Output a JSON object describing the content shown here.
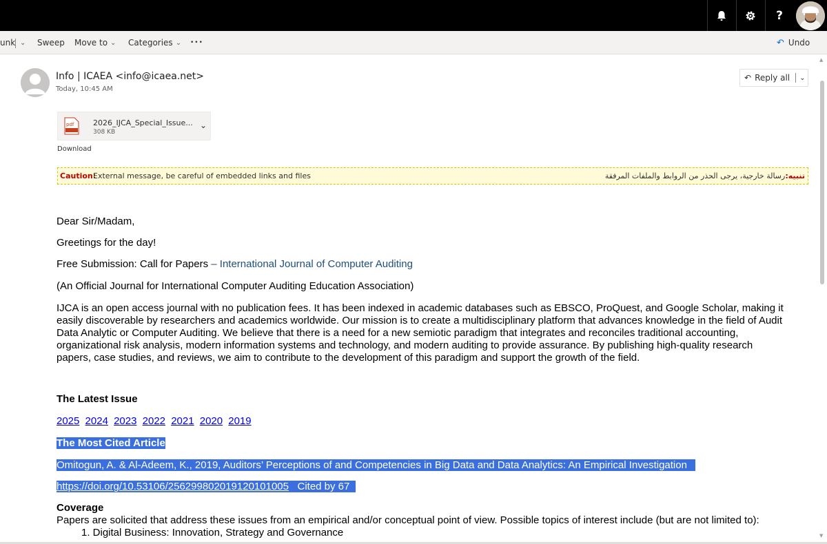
{
  "topbar": {
    "icons": [
      "bell-icon",
      "gear-icon",
      "help-icon",
      "profile-avatar"
    ],
    "help_label": "?"
  },
  "commandbar": {
    "junk_label": "unk",
    "sweep_label": "Sweep",
    "move_label": "Move to",
    "categories_label": "Categories",
    "more_label": "•••",
    "undo_label": "Undo"
  },
  "message": {
    "sender": "Info | ICAEA <info@icaea.net>",
    "time": "Today, 10:45 AM",
    "reply_label": "Reply all",
    "attachment": {
      "icon_text": "pdf",
      "name": "2026_IJCA_Special_Issue...",
      "size": "308 KB"
    },
    "download_label": "Download",
    "caution": {
      "label": "Caution:",
      "text": "External message, be careful of embedded links and files",
      "ar_label": "تنبيه:",
      "ar_text": "رسالة خارجية، يرجى الحذر من الروابط والملفات المرفقة"
    }
  },
  "email": {
    "salutation": "Dear Sir/Madam,",
    "greeting": "Greetings for the day!",
    "cfp_prefix": "Free Submission: Call for Papers ",
    "cfp_link": "– International Journal of Computer Auditing",
    "official": "(An Official Journal for International Computer Auditing Education Association)",
    "intro_lines": [
      "IJCA is an open access journal with no publication fees. It has been indexed in academic databases such as EBSCO, ProQuest, and Google Scholar, making it",
      "easily discoverable by researchers and academics worldwide. Our mission is to create a multidisciplinary platform that advances knowledge in the field of Audit",
      "Data Analytic or Computer Auditing. We believe that there is a need for a new semiotic paradigm that integrates and reconciles traditional accounting,",
      "organizational risk analysis, modern information systems and technology, and modern auditing to provide assurance. By publishing high-quality research",
      "papers, case studies, and reviews, we aim to contribute to the development of this paradigm and support the growth of the field."
    ],
    "latest_issue_heading": "The Latest Issue",
    "years": [
      "2025",
      "2024",
      "2023",
      "2022",
      "2021",
      "2020",
      "2019"
    ],
    "most_cited_heading": "The Most Cited Article",
    "citation": "Omitogun, A. & Al-Adeem, K., 2019, Auditors’ Perceptions of and Competencies in Big Data and Data Analytics: An Empirical Investigation ",
    "doi": "https://doi.org/10.53106/25629980201912010100",
    "doi_last": "5",
    "cited_by": "   Cited by 67  ",
    "coverage_heading": "Coverage",
    "coverage_text": "Papers are solicited that address these issues from an empirical and/or conceptual point of view. Possible topics of interest include (but are not limited to):",
    "topics": [
      "1. Digital Business: Innovation, Strategy and Governance"
    ]
  },
  "colors": {
    "topbar": "#000000",
    "commandbar": "#f3f2f1",
    "caution_bg": "#fffbd9",
    "caution_label": "#c00000",
    "highlight": "#3a6fdd",
    "link": "#0000ee"
  }
}
